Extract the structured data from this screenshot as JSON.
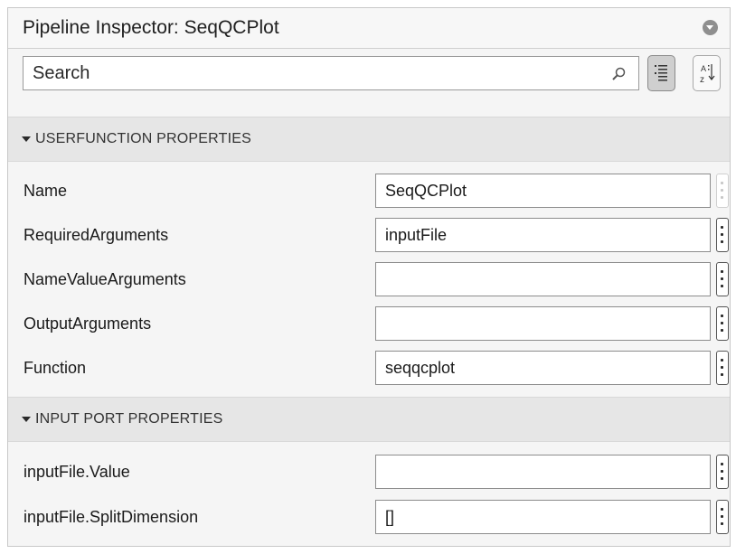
{
  "panel": {
    "title": "Pipeline Inspector: SeqQCPlot"
  },
  "search": {
    "placeholder": "Search"
  },
  "icons": {
    "panel_menu": "circle-chevron-down-icon",
    "search": "magnifier-icon",
    "categorized_view": "categorized-list-icon",
    "sort_alpha": "sort-a-to-z-icon",
    "row_menu": "vertical-ellipsis-icon"
  },
  "sections": [
    {
      "title": "USERFUNCTION PROPERTIES",
      "properties": [
        {
          "label": "Name",
          "value": "SeqQCPlot"
        },
        {
          "label": "RequiredArguments",
          "value": "inputFile"
        },
        {
          "label": "NameValueArguments",
          "value": ""
        },
        {
          "label": "OutputArguments",
          "value": ""
        },
        {
          "label": "Function",
          "value": "seqqcplot"
        }
      ]
    },
    {
      "title": "INPUT PORT PROPERTIES",
      "properties": [
        {
          "label": "inputFile.Value",
          "value": ""
        },
        {
          "label": "inputFile.SplitDimension",
          "value": "[]"
        }
      ]
    }
  ],
  "colors": {
    "panel_bg": "#f5f5f5",
    "section_header_bg": "#e6e6e6",
    "field_border": "#8c8c8c",
    "active_toggle_bg": "#cfcfcf"
  }
}
